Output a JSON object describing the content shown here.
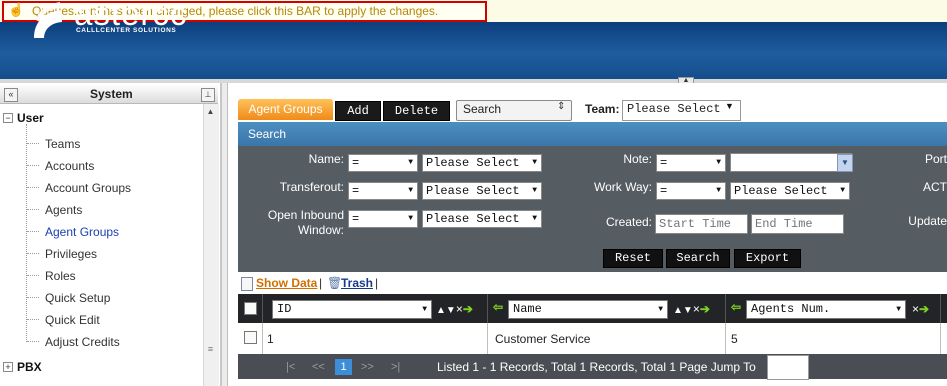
{
  "notice": {
    "text": "Queues.conf has been changed, please click this BAR to apply the changes."
  },
  "header": {
    "logo_text": "astercc",
    "logo_sub": "CALLLCENTER SOLUTIONS"
  },
  "left_panel": {
    "title": "System",
    "tree": {
      "root_user": "User",
      "items": [
        "Teams",
        "Accounts",
        "Account Groups",
        "Agents",
        "Agent Groups",
        "Privileges",
        "Roles",
        "Quick Setup",
        "Quick Edit",
        "Adjust Credits"
      ],
      "active_item": "Agent Groups",
      "root_pbx": "PBX"
    }
  },
  "toolbar": {
    "tab_label": "Agent Groups",
    "add_label": "Add",
    "delete_label": "Delete",
    "search_select": "Search",
    "team_label": "Team:",
    "team_value": "Please Select"
  },
  "search": {
    "title": "Search",
    "fields": {
      "name": {
        "label": "Name:",
        "op": "=",
        "value": "Please Select"
      },
      "transferout": {
        "label": "Transferout:",
        "op": "=",
        "value": "Please Select"
      },
      "open_inbound": {
        "label": "Open Inbound Window:",
        "op": "=",
        "value": "Please Select"
      },
      "note": {
        "label": "Note:",
        "op": "=",
        "value": ""
      },
      "work_way": {
        "label": "Work Way:",
        "op": "=",
        "value": "Please Select"
      },
      "created": {
        "label": "Created:",
        "start_placeholder": "Start Time",
        "end_placeholder": "End Time"
      },
      "port": {
        "label": "Port"
      },
      "act": {
        "label": "ACT"
      },
      "update": {
        "label": "Update"
      }
    },
    "reset_label": "Reset",
    "search_label": "Search",
    "export_label": "Export"
  },
  "links": {
    "show_data": "Show Data",
    "trash": "Trash",
    "sep": "|"
  },
  "grid": {
    "columns": [
      "ID",
      "Name",
      "Agents Num."
    ],
    "rows": [
      {
        "id": "1",
        "name": "Customer Service",
        "agents_num": "5"
      }
    ],
    "pager": {
      "first": "|<",
      "prev": "<<",
      "current": "1",
      "next": ">>",
      "last": ">|"
    },
    "records_text": "Listed 1 - 1 Records, Total 1 Records, Total 1 Page Jump To"
  },
  "colors": {
    "accent_orange": "#f08a18",
    "header_blue": "#1f5d9f",
    "search_bar_blue": "#3a75a8",
    "notice_border": "#d40000"
  },
  "icons": [
    "hand-pointer-icon",
    "logo-mark-icon",
    "collapse-left-icon",
    "pin-icon",
    "scroll-up-icon",
    "scroll-grip-icon",
    "show-data-icon",
    "trash-icon",
    "arrow-left-icon",
    "arrow-right-icon",
    "sort-up-icon",
    "sort-down-icon",
    "close-icon"
  ]
}
